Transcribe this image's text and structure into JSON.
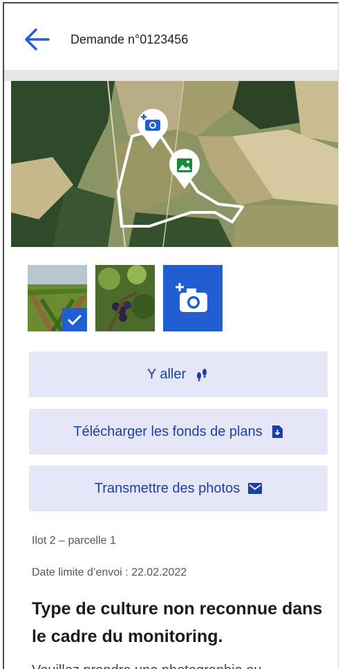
{
  "header": {
    "back_icon": "arrow-left-icon",
    "title": "Demande n°0123456"
  },
  "map": {
    "markers": [
      {
        "icon": "camera-plus-icon"
      },
      {
        "icon": "image-icon"
      }
    ]
  },
  "thumbnails": [
    {
      "label": "vineyard-rows",
      "selected": true
    },
    {
      "label": "grape-vine",
      "selected": false
    },
    {
      "label": "add-photo",
      "icon": "camera-plus-icon"
    }
  ],
  "actions": {
    "go": {
      "label": "Y aller",
      "icon": "footsteps-icon"
    },
    "download": {
      "label": "Télécharger les fonds de plans",
      "icon": "download-file-icon"
    },
    "send": {
      "label": "Transmettre des photos",
      "icon": "mail-icon"
    }
  },
  "details": {
    "plot": "Ilot 2 – parcelle 1",
    "deadline": "Date limite d’envoi : 22.02.2022",
    "headline": "Type  de culture non reconnue dans le cadre du monitoring.",
    "instruction_partial": "Veuillez prendre une photographie ou"
  },
  "colors": {
    "accent": "#1f5fd1",
    "button_bg": "#e5e6f7",
    "button_text": "#1f3ea3"
  }
}
